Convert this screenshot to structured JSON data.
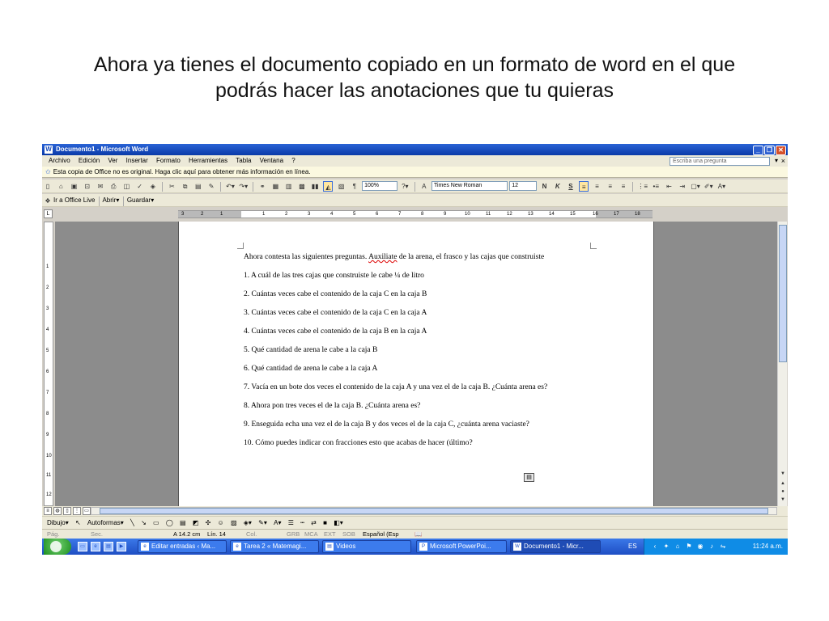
{
  "slide": {
    "title_line1": "Ahora ya tienes el documento copiado en un formato de word en el que",
    "title_line2": "podrás hacer las anotaciones que tu quieras"
  },
  "window": {
    "title": "Documento1 - Microsoft Word",
    "app_icon": "word-icon"
  },
  "menu": {
    "items": [
      "Archivo",
      "Edición",
      "Ver",
      "Insertar",
      "Formato",
      "Herramientas",
      "Tabla",
      "Ventana",
      "?"
    ],
    "ask_placeholder": "Escriba una pregunta"
  },
  "infobar": {
    "message": "Esta copia de Office no es original.  Haga clic aquí para obtener más información en línea."
  },
  "toolbar": {
    "zoom": "100%",
    "font": "Times New Roman",
    "size": "12",
    "bold": "N",
    "italic": "K",
    "underline": "S",
    "pilcrow": "¶",
    "office_live": "Ir a Office Live",
    "open": "Abrir",
    "save": "Guardar"
  },
  "ruler": {
    "numbers": [
      "3",
      "2",
      "1",
      "1",
      "2",
      "3",
      "4",
      "5",
      "6",
      "7",
      "8",
      "9",
      "10",
      "11",
      "12",
      "13",
      "14",
      "15",
      "16",
      "17",
      "18"
    ],
    "vnumbers": [
      "1",
      "2",
      "3",
      "4",
      "5",
      "6",
      "7",
      "8",
      "9",
      "10",
      "11",
      "12"
    ]
  },
  "document": {
    "intro_part1": "Ahora contesta las  siguientes preguntas. ",
    "intro_underlined": "Auxiliate",
    "intro_part2": " de la arena, el frasco y las cajas que construiste",
    "questions": [
      "1. A cuál de las tres cajas que construiste le cabe ¼ de litro",
      "2. Cuántas veces cabe el contenido de la caja C en la caja B",
      "3. Cuántas veces cabe el contenido de la caja C en la caja A",
      "4. Cuántas veces cabe el contenido de la caja B en la caja A",
      "5. Qué cantidad de arena le cabe a la caja B",
      "6. Qué cantidad de arena le cabe a la caja A",
      "7. Vacía en un bote dos veces el contenido de la caja A y una vez el de la caja B. ¿Cuánta arena es?",
      "8. Ahora pon tres veces el de la caja B. ¿Cuánta arena es?",
      "9. Enseguida echa una vez el de la caja B y dos veces el de la caja C, ¿cuánta arena vaciaste?",
      "10. Cómo puedes indicar con fracciones esto que acabas de hacer (último?"
    ]
  },
  "drawbar": {
    "draw": "Dibujo",
    "autoshapes": "Autoformas"
  },
  "status": {
    "page": "Pág.",
    "sec": "Sec.",
    "at": "A  14.2 cm",
    "line": "Lín.  14",
    "col": "Col.",
    "rec": "GRB",
    "trk": "MCA",
    "ext": "EXT",
    "ovr": "SOB",
    "lang": "Español (Esp"
  },
  "taskbar": {
    "tasks": [
      "Editar entradas ‹ Ma...",
      "Tarea 2 « Matemagi...",
      "Videos",
      "Microsoft PowerPoi...",
      "Documento1 - Micr..."
    ],
    "lang": "ES",
    "time": "11:24 a.m."
  }
}
